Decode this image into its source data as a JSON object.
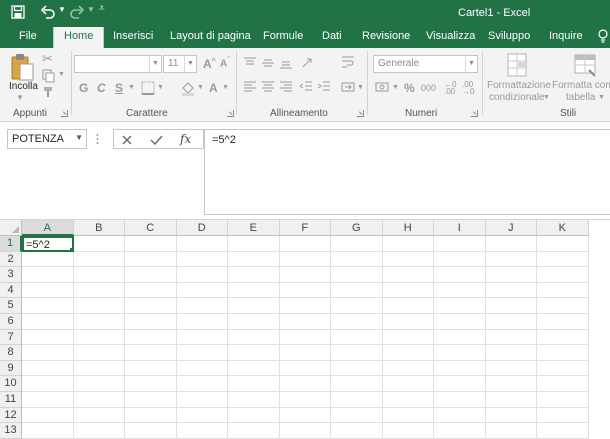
{
  "window": {
    "title": "Cartel1 - Excel"
  },
  "quick_access": {
    "icons": [
      "save-icon",
      "undo-icon",
      "redo-icon",
      "customize-qat-icon"
    ]
  },
  "tabs": [
    {
      "label": "File"
    },
    {
      "label": "Home"
    },
    {
      "label": "Inserisci"
    },
    {
      "label": "Layout di pagina"
    },
    {
      "label": "Formule"
    },
    {
      "label": "Dati"
    },
    {
      "label": "Revisione"
    },
    {
      "label": "Visualizza"
    },
    {
      "label": "Sviluppo"
    },
    {
      "label": "Inquire"
    }
  ],
  "ribbon": {
    "clipboard": {
      "paste_label": "Incolla",
      "group_label": "Appunti"
    },
    "font": {
      "font_name": "",
      "font_size": "11",
      "bold": "G",
      "italic": "C",
      "underline": "S",
      "group_label": "Carattere"
    },
    "alignment": {
      "group_label": "Allineamento"
    },
    "number": {
      "format": "Generale",
      "percent": "%",
      "thousands": "000",
      "group_label": "Numeri"
    },
    "styles": {
      "conditional_label_1": "Formattazione",
      "conditional_label_2": "condizionale",
      "table_label_1": "Formatta come",
      "table_label_2": "tabella",
      "group_label": "Stili"
    }
  },
  "formula_bar": {
    "name_box": "POTENZA",
    "fx": "fx",
    "content": "=5^2"
  },
  "sheet": {
    "columns": [
      "A",
      "B",
      "C",
      "D",
      "E",
      "F",
      "G",
      "H",
      "I",
      "J",
      "K"
    ],
    "rows": [
      "1",
      "2",
      "3",
      "4",
      "5",
      "6",
      "7",
      "8",
      "9",
      "10",
      "11",
      "12",
      "13"
    ],
    "active_cell": {
      "ref": "A1",
      "value": "=5^2"
    }
  },
  "colors": {
    "accent": "#217346"
  }
}
